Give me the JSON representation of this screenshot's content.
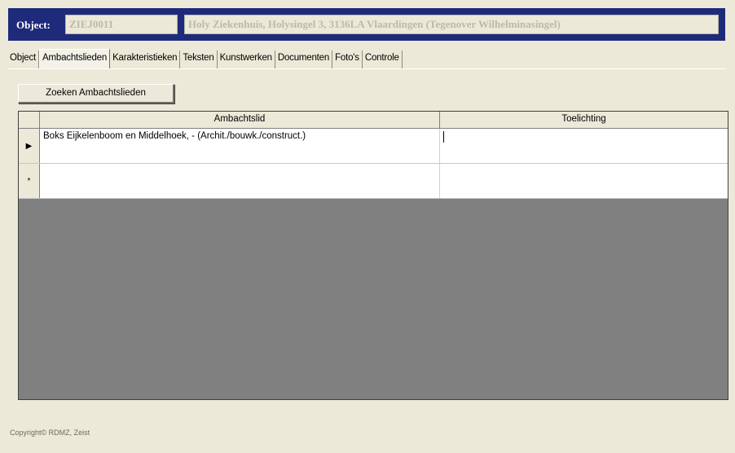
{
  "header": {
    "label": "Object:",
    "object_id": "ZIEJ0011",
    "object_description": "Holy Ziekenhuis, Holysingel 3, 3136LA Vlaardingen (Tegenover Wilhelminasingel)"
  },
  "tabs": [
    {
      "label": "Object"
    },
    {
      "label": "Ambachtslieden"
    },
    {
      "label": "Karakteristieken"
    },
    {
      "label": "Teksten"
    },
    {
      "label": "Kunstwerken"
    },
    {
      "label": "Documenten"
    },
    {
      "label": "Foto's"
    },
    {
      "label": "Controle"
    }
  ],
  "active_tab": "Ambachtslieden",
  "search_button": {
    "label": "Zoeken Ambachtslieden"
  },
  "grid": {
    "columns": [
      "Ambachtslid",
      "Toelichting"
    ],
    "rows": [
      {
        "selector": "▶",
        "ambachtslid": "Boks Eijkelenboom en Middelhoek,  -  (Archit./bouwk./construct.)",
        "toelichting": ""
      },
      {
        "selector": "*",
        "ambachtslid": "",
        "toelichting": ""
      }
    ]
  },
  "footer": {
    "text": "Copyright© RDMZ, Zeist"
  },
  "colors": {
    "header_bg": "#1e2a7a",
    "window_bg": "#ece9d8",
    "grid_empty": "#808080"
  }
}
